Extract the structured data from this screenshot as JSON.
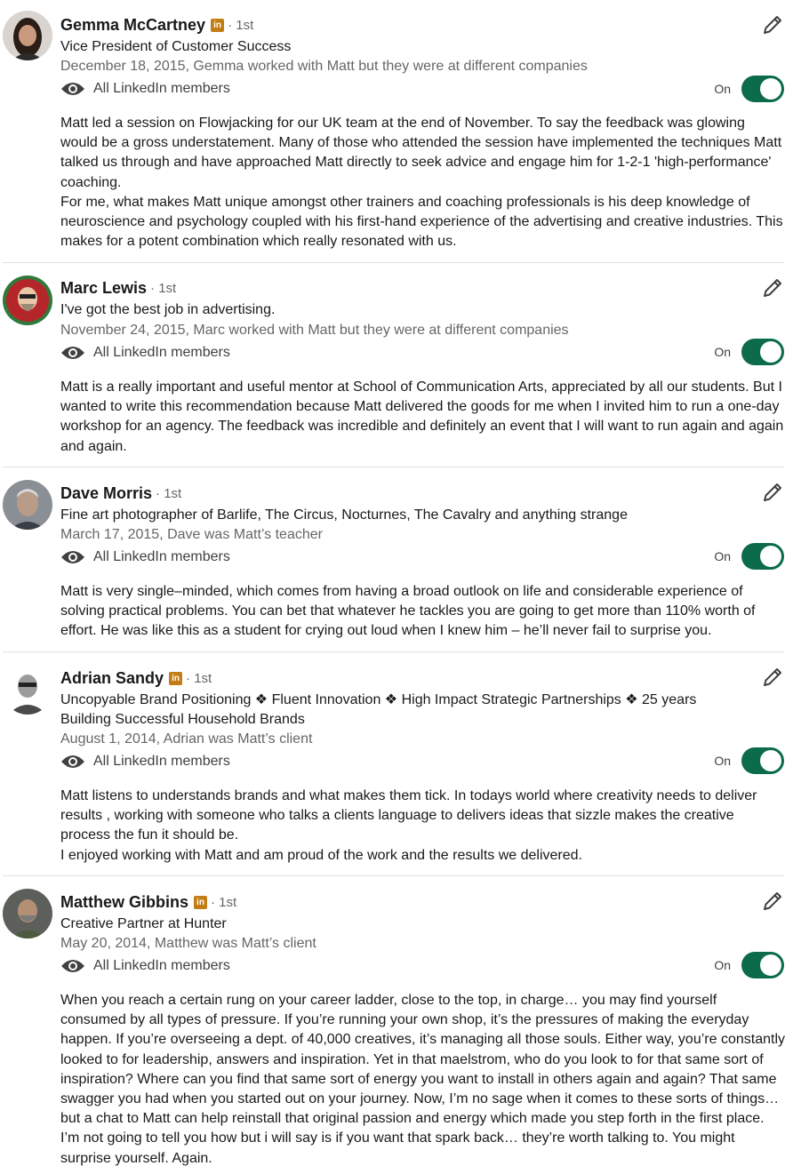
{
  "recommendations": [
    {
      "name": "Gemma McCartney",
      "linkedin_badge": true,
      "degree": "· 1st",
      "headline": "Vice President of Customer Success",
      "meta": "December 18, 2015, Gemma worked with Matt but they were at different companies",
      "visibility": "All LinkedIn members",
      "toggle_label": "On",
      "toggle_on": true,
      "body": [
        "Matt led a session on Flowjacking for our UK team at the end of November. To say the feedback was glowing would be a gross understatement. Many of those who attended the session have implemented the techniques Matt talked us through and have approached Matt directly to seek advice and engage him for 1-2-1 'high-performance' coaching.",
        "For me, what makes Matt unique amongst other trainers and coaching professionals is his deep knowledge of neuroscience and psychology coupled with his first-hand experience of the advertising and creative industries. This makes for a potent combination which really resonated with us."
      ]
    },
    {
      "name": "Marc Lewis",
      "linkedin_badge": false,
      "degree": "· 1st",
      "headline": "I've got the best job in advertising.",
      "meta": "November 24, 2015, Marc worked with Matt but they were at different companies",
      "visibility": "All LinkedIn members",
      "toggle_label": "On",
      "toggle_on": true,
      "body": [
        "Matt is a really important and useful mentor at School of Communication Arts, appreciated by all our students. But I wanted to write this recommendation because Matt delivered the goods for me when I invited him to run a one-day workshop for an agency. The feedback was incredible and definitely an event that I will want to run again and again and again."
      ]
    },
    {
      "name": "Dave Morris",
      "linkedin_badge": false,
      "degree": "· 1st",
      "headline": "Fine art photographer of Barlife, The Circus, Nocturnes, The Cavalry and anything strange",
      "meta": "March 17, 2015, Dave was Matt’s teacher",
      "visibility": "All LinkedIn members",
      "toggle_label": "On",
      "toggle_on": true,
      "body": [
        "Matt is very single–minded, which comes from having a broad outlook on life and considerable experience of solving practical problems. You can bet that whatever he tackles you are going to get more than 110% worth of effort. He was like this as a student for crying out loud when I knew him – he’ll never fail to surprise you."
      ]
    },
    {
      "name": "Adrian Sandy",
      "linkedin_badge": true,
      "degree": "· 1st",
      "headline": "Uncopyable Brand Positioning ❖ Fluent Innovation ❖ High Impact Strategic Partnerships ❖ 25 years Building Successful Household Brands",
      "meta": "August 1, 2014, Adrian was Matt’s client",
      "visibility": "All LinkedIn members",
      "toggle_label": "On",
      "toggle_on": true,
      "body": [
        "Matt listens to understands brands and what makes them tick. In todays world where creativity needs to deliver results , working with someone who talks a clients language to delivers ideas that sizzle makes the creative process the fun it should be.",
        "I enjoyed working with Matt and am proud of the work and the results we delivered."
      ]
    },
    {
      "name": "Matthew Gibbins",
      "linkedin_badge": true,
      "degree": "· 1st",
      "headline": "Creative Partner at Hunter",
      "meta": "May 20, 2014, Matthew was Matt’s client",
      "visibility": "All LinkedIn members",
      "toggle_label": "On",
      "toggle_on": true,
      "body": [
        "When you reach a certain rung on your career ladder, close to the top, in charge… you may find yourself consumed by all types of pressure. If you’re running your own shop, it’s the pressures of making the everyday happen. If you’re overseeing a dept. of 40,000 creatives, it’s managing all those souls. Either way, you’re constantly looked to for leadership, answers and inspiration. Yet in that maelstrom, who do you look to for that same sort of inspiration? Where can you find that same sort of energy you want to install in others again and again? That same swagger you had when you started out on your journey. Now, I’m no sage when it comes to these sorts of things… but a chat to Matt can help reinstall that original passion and energy which made you step forth in the first place. I’m not going to tell you how but i will say is if you want that spark back… they’re worth talking to. You might surprise yourself. Again."
      ]
    }
  ],
  "badge_text": "in",
  "colors": {
    "toggle_on": "#0b6b4a",
    "linkedin_badge": "#c37d16",
    "secondary_text": "#666666"
  }
}
